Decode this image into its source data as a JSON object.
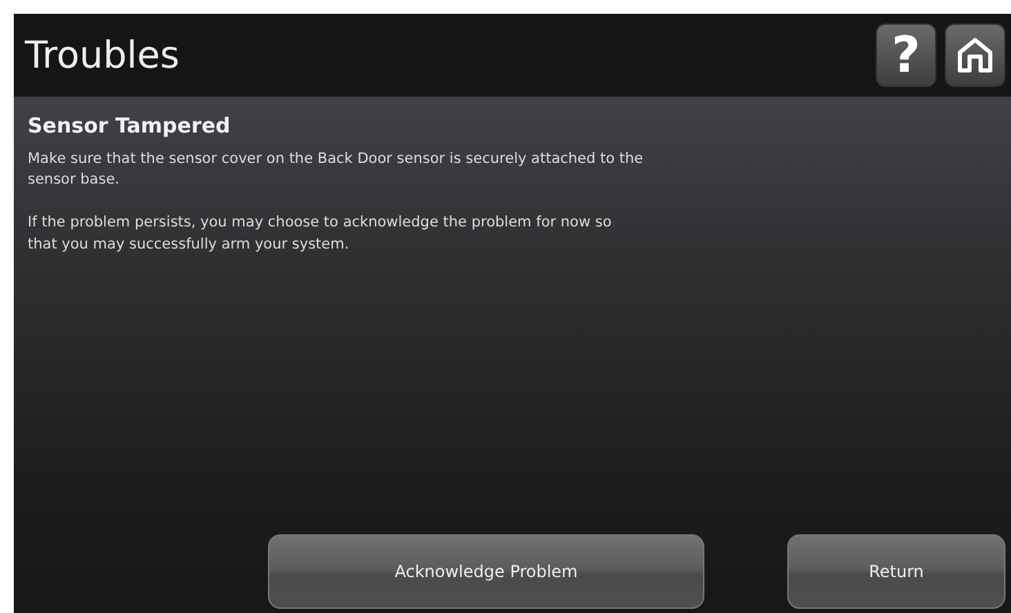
{
  "header": {
    "title": "Troubles",
    "help_button": "?"
  },
  "trouble": {
    "heading": "Sensor Tampered",
    "paragraphs": [
      "Make sure that the sensor cover on the Back Door sensor is securely attached to the\n sensor base.",
      "If the problem persists, you may choose to acknowledge the problem for now so\nthat you may successfully arm your system."
    ]
  },
  "buttons": [
    {
      "label": "Acknowledge Problem",
      "kind": "wide"
    },
    {
      "label": "Return",
      "kind": "narrow"
    }
  ]
}
